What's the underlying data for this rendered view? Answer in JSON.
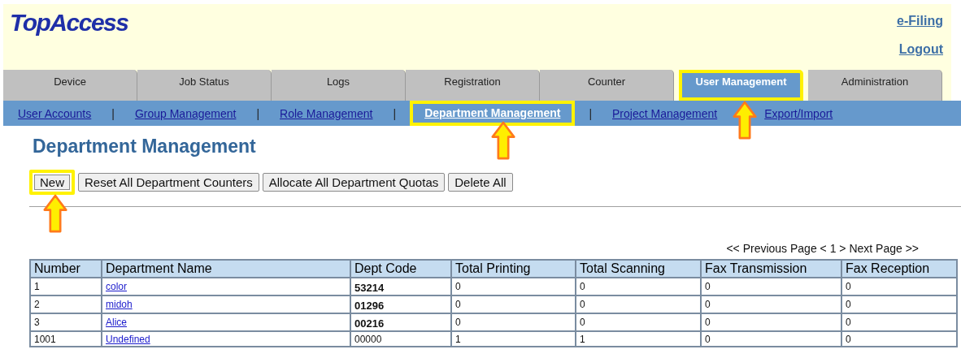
{
  "header": {
    "logo": "TopAccess",
    "links": [
      "e-Filing",
      "Logout"
    ]
  },
  "tabs": [
    {
      "label": "Device",
      "selected": false,
      "highlighted": false
    },
    {
      "label": "Job Status",
      "selected": false,
      "highlighted": false
    },
    {
      "label": "Logs",
      "selected": false,
      "highlighted": false
    },
    {
      "label": "Registration",
      "selected": false,
      "highlighted": false
    },
    {
      "label": "Counter",
      "selected": false,
      "highlighted": false
    },
    {
      "label": "User Management",
      "selected": true,
      "highlighted": true
    },
    {
      "label": "Administration",
      "selected": false,
      "highlighted": false
    }
  ],
  "subnav": [
    {
      "label": "User Accounts",
      "selected": false,
      "highlighted": false
    },
    {
      "label": "Group Management",
      "selected": false,
      "highlighted": false,
      "separator": "|"
    },
    {
      "label": "Role Management",
      "selected": false,
      "highlighted": false,
      "separator": "|"
    },
    {
      "label": "Department Management",
      "selected": true,
      "highlighted": true,
      "separator": "|"
    },
    {
      "label": "Project Management",
      "selected": false,
      "highlighted": false,
      "separator": "|"
    },
    {
      "label": "Export/Import",
      "selected": false,
      "highlighted": false
    }
  ],
  "page_title": "Department Management",
  "buttons": [
    {
      "label": "New",
      "highlighted": true
    },
    {
      "label": "Reset All Department Counters",
      "highlighted": false
    },
    {
      "label": "Allocate All Department Quotas",
      "highlighted": false
    },
    {
      "label": "Delete All",
      "highlighted": false
    }
  ],
  "pagination": "<< Previous Page < 1 > Next Page >>",
  "table": {
    "columns": [
      "Number",
      "Department Name",
      "Dept Code",
      "Total Printing",
      "Total Scanning",
      "Fax Transmission",
      "Fax Reception"
    ],
    "rows": [
      {
        "number": "1",
        "name": "color",
        "code": "53214",
        "code_bold": true,
        "values": [
          "0",
          "0",
          "0",
          "0"
        ]
      },
      {
        "number": "2",
        "name": "midoh",
        "code": "01296",
        "code_bold": true,
        "values": [
          "0",
          "0",
          "0",
          "0"
        ]
      },
      {
        "number": "3",
        "name": "Alice",
        "code": "00216",
        "code_bold": true,
        "values": [
          "0",
          "0",
          "0",
          "0"
        ]
      },
      {
        "number": "1001",
        "name": "Undefined",
        "code": "00000",
        "code_bold": false,
        "values": [
          "1",
          "1",
          "0",
          "0"
        ]
      }
    ]
  }
}
